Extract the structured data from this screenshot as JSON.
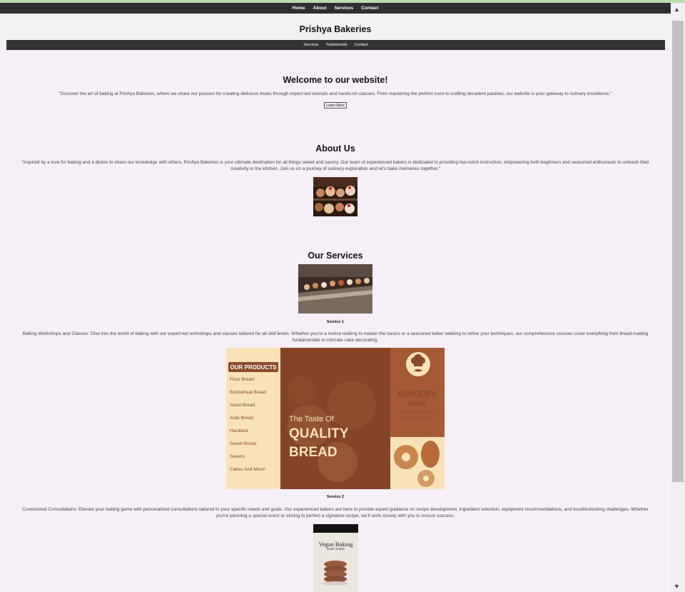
{
  "top_nav": [
    "Home",
    "About",
    "Services",
    "Contact"
  ],
  "site_title": "Prishya Bakeries",
  "sub_nav": [
    "Services",
    "Testimonials",
    "Contact"
  ],
  "welcome": {
    "title": "Welcome to our website!",
    "text": "\"Discover the art of baking at Prishya Bakeries, where we share our passion for creating delicious treats through expert-led tutorials and hands-on classes. From mastering the perfect crust to crafting decadent pastries, our website is your gateway to culinary excellence.\"",
    "button": "Learn More"
  },
  "about": {
    "title": "About Us",
    "text": "\"Inspired by a love for baking and a desire to share our knowledge with others, Prishya Bakeries is your ultimate destination for all things sweet and savory. Our team of experienced bakers is dedicated to providing top-notch instruction, empowering both beginners and seasoned enthusiasts to unleash their creativity in the kitchen. Join us on a journey of culinary exploration and let's bake memories together.\""
  },
  "services": {
    "title": "Our Services",
    "items": [
      {
        "label": "Service 1",
        "text": "Baking Workshops and Classes: Dive into the world of baking with our expert-led workshops and classes tailored for all skill levels. Whether you're a novice looking to master the basics or a seasoned baker seeking to refine your techniques, our comprehensive courses cover everything from bread-making fundamentals to intricate cake decorating."
      },
      {
        "label": "Service 2",
        "text": "Customized Consultations: Elevate your baking game with personalized consultations tailored to your specific needs and goals. Our experienced bakers are here to provide expert guidance on recipe development, ingredient selection, equipment recommendations, and troubleshooting challenges. Whether you're planning a special event or aiming to perfect a signature recipe, we'll work closely with you to ensure success."
      }
    ]
  },
  "poster": {
    "products_heading": "OUR PRODUCTS",
    "products": [
      "Flour Bread",
      "Buckwheat Bread",
      "Yeast Bread",
      "Arab Bread",
      "Hardtack",
      "Sweet Bread",
      "Sweets",
      "Cakes And More!"
    ],
    "tagline_small": "The Taste Of",
    "tagline_big_1": "QUALITY",
    "tagline_big_2": "BREAD",
    "brand_1": "BAKERY",
    "brand_2": "NAME",
    "brand_sub": "Delicious Treats From Your Local Bakers!"
  },
  "book": {
    "title": "Vegan Baking",
    "subtitle": "made simple"
  },
  "colors": {
    "nav_bg": "#2f2f2f",
    "page_bg": "#f6eff7",
    "poster_brown": "#8a4a2c",
    "poster_cream": "#f8e3b8"
  }
}
